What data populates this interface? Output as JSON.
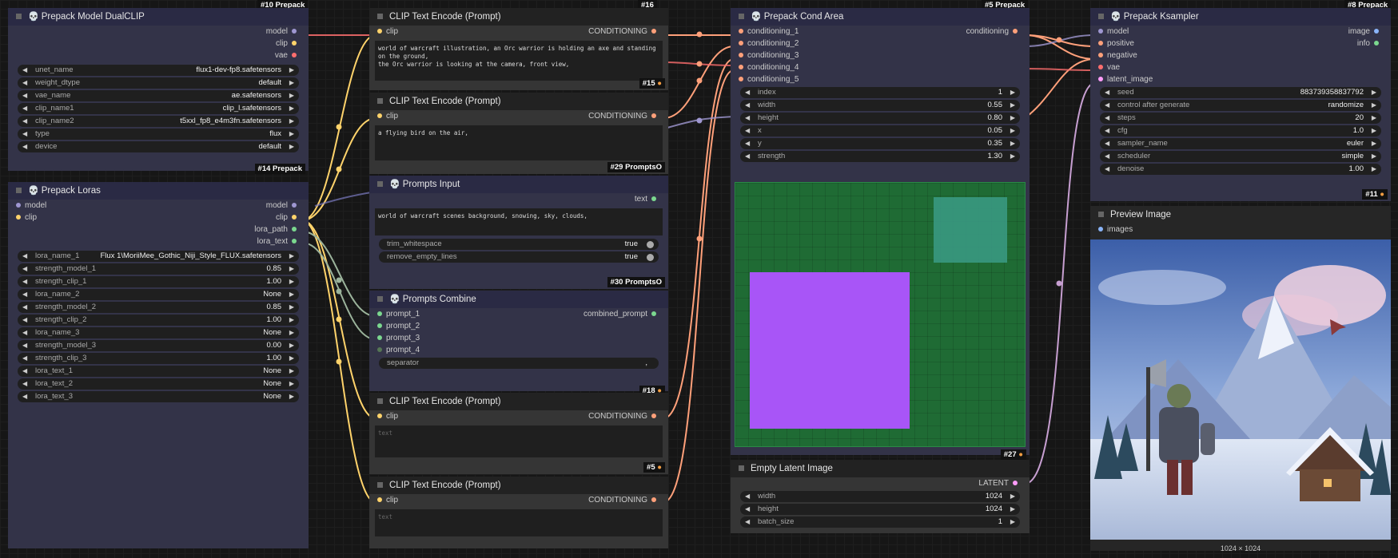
{
  "colors": {
    "clip": "#ffd36b",
    "model": "#9f97d1",
    "vae": "#ff6e6e",
    "conditioning": "#ffa07a",
    "latent": "#ff9cf9",
    "string": "#7bd88f",
    "image": "#8ab4f8"
  },
  "topbadges": [
    "#10 Prepack",
    "#16",
    "#5 Prepack",
    "#8 Prepack"
  ],
  "node_dualclip": {
    "title": "Prepack Model DualCLIP",
    "outputs": [
      "model",
      "clip",
      "vae"
    ],
    "widgets": [
      {
        "label": "unet_name",
        "value": "flux1-dev-fp8.safetensors"
      },
      {
        "label": "weight_dtype",
        "value": "default"
      },
      {
        "label": "vae_name",
        "value": "ae.safetensors"
      },
      {
        "label": "clip_name1",
        "value": "clip_l.safetensors"
      },
      {
        "label": "clip_name2",
        "value": "t5xxl_fp8_e4m3fn.safetensors"
      },
      {
        "label": "type",
        "value": "flux"
      },
      {
        "label": "device",
        "value": "default"
      }
    ],
    "badge": "#14 Prepack"
  },
  "node_loras": {
    "title": "Prepack Loras",
    "inputs": [
      "model",
      "clip"
    ],
    "outputs": [
      "model",
      "clip",
      "lora_path",
      "lora_text"
    ],
    "widgets": [
      {
        "label": "lora_name_1",
        "value": "Flux 1\\MoriiMee_Gothic_Niji_Style_FLUX.safetensors"
      },
      {
        "label": "strength_model_1",
        "value": "0.85"
      },
      {
        "label": "strength_clip_1",
        "value": "1.00"
      },
      {
        "label": "lora_name_2",
        "value": "None"
      },
      {
        "label": "strength_model_2",
        "value": "0.85"
      },
      {
        "label": "strength_clip_2",
        "value": "1.00"
      },
      {
        "label": "lora_name_3",
        "value": "None"
      },
      {
        "label": "strength_model_3",
        "value": "0.00"
      },
      {
        "label": "strength_clip_3",
        "value": "1.00"
      },
      {
        "label": "lora_text_1",
        "value": "None"
      },
      {
        "label": "lora_text_2",
        "value": "None"
      },
      {
        "label": "lora_text_3",
        "value": "None"
      }
    ]
  },
  "clip1": {
    "title": "CLIP Text Encode (Prompt)",
    "input": "clip",
    "output": "CONDITIONING",
    "text": "world of warcraft illustration, an Orc warrior is holding an axe and standing on the ground,\nthe Orc warrior is looking at the camera, front view,",
    "badge": "#15"
  },
  "clip2": {
    "title": "CLIP Text Encode (Prompt)",
    "input": "clip",
    "output": "CONDITIONING",
    "text": "a flying bird on the air,",
    "badge": "#29 PromptsO"
  },
  "prompts_input": {
    "title": "Prompts Input",
    "output": "text",
    "text": "world of warcraft scenes background, snowing, sky, clouds,",
    "trim_label": "trim_whitespace",
    "trim_value": "true",
    "remove_label": "remove_empty_lines",
    "remove_value": "true",
    "badge": "#30 PromptsO"
  },
  "prompts_combine": {
    "title": "Prompts Combine",
    "inputs": [
      "prompt_1",
      "prompt_2",
      "prompt_3",
      "prompt_4"
    ],
    "output": "combined_prompt",
    "sep_label": "separator",
    "sep_value": ",",
    "badge": "#18"
  },
  "clip3": {
    "title": "CLIP Text Encode (Prompt)",
    "input": "clip",
    "output": "CONDITIONING",
    "placeholder": "text",
    "badge": "#5"
  },
  "clip4": {
    "title": "CLIP Text Encode (Prompt)",
    "input": "clip",
    "output": "CONDITIONING",
    "placeholder": "text"
  },
  "cond_area": {
    "title": "Prepack Cond Area",
    "inputs": [
      "conditioning_1",
      "conditioning_2",
      "conditioning_3",
      "conditioning_4",
      "conditioning_5"
    ],
    "output": "conditioning",
    "widgets": [
      {
        "label": "index",
        "value": "1"
      },
      {
        "label": "width",
        "value": "0.55"
      },
      {
        "label": "height",
        "value": "0.80"
      },
      {
        "label": "x",
        "value": "0.05"
      },
      {
        "label": "y",
        "value": "0.35"
      },
      {
        "label": "strength",
        "value": "1.30"
      }
    ],
    "badge": "#27"
  },
  "empty_latent": {
    "title": "Empty Latent Image",
    "output": "LATENT",
    "widgets": [
      {
        "label": "width",
        "value": "1024"
      },
      {
        "label": "height",
        "value": "1024"
      },
      {
        "label": "batch_size",
        "value": "1"
      }
    ]
  },
  "ksampler": {
    "title": "Prepack Ksampler",
    "inputs": [
      "model",
      "positive",
      "negative",
      "vae",
      "latent_image"
    ],
    "outputs": [
      "image",
      "info"
    ],
    "widgets": [
      {
        "label": "seed",
        "value": "883739358837792"
      },
      {
        "label": "control after generate",
        "value": "randomize"
      },
      {
        "label": "steps",
        "value": "20"
      },
      {
        "label": "cfg",
        "value": "1.0"
      },
      {
        "label": "sampler_name",
        "value": "euler"
      },
      {
        "label": "scheduler",
        "value": "simple"
      },
      {
        "label": "denoise",
        "value": "1.00"
      }
    ],
    "badge": "#11"
  },
  "preview": {
    "title": "Preview Image",
    "input": "images",
    "size": "1024 × 1024"
  }
}
